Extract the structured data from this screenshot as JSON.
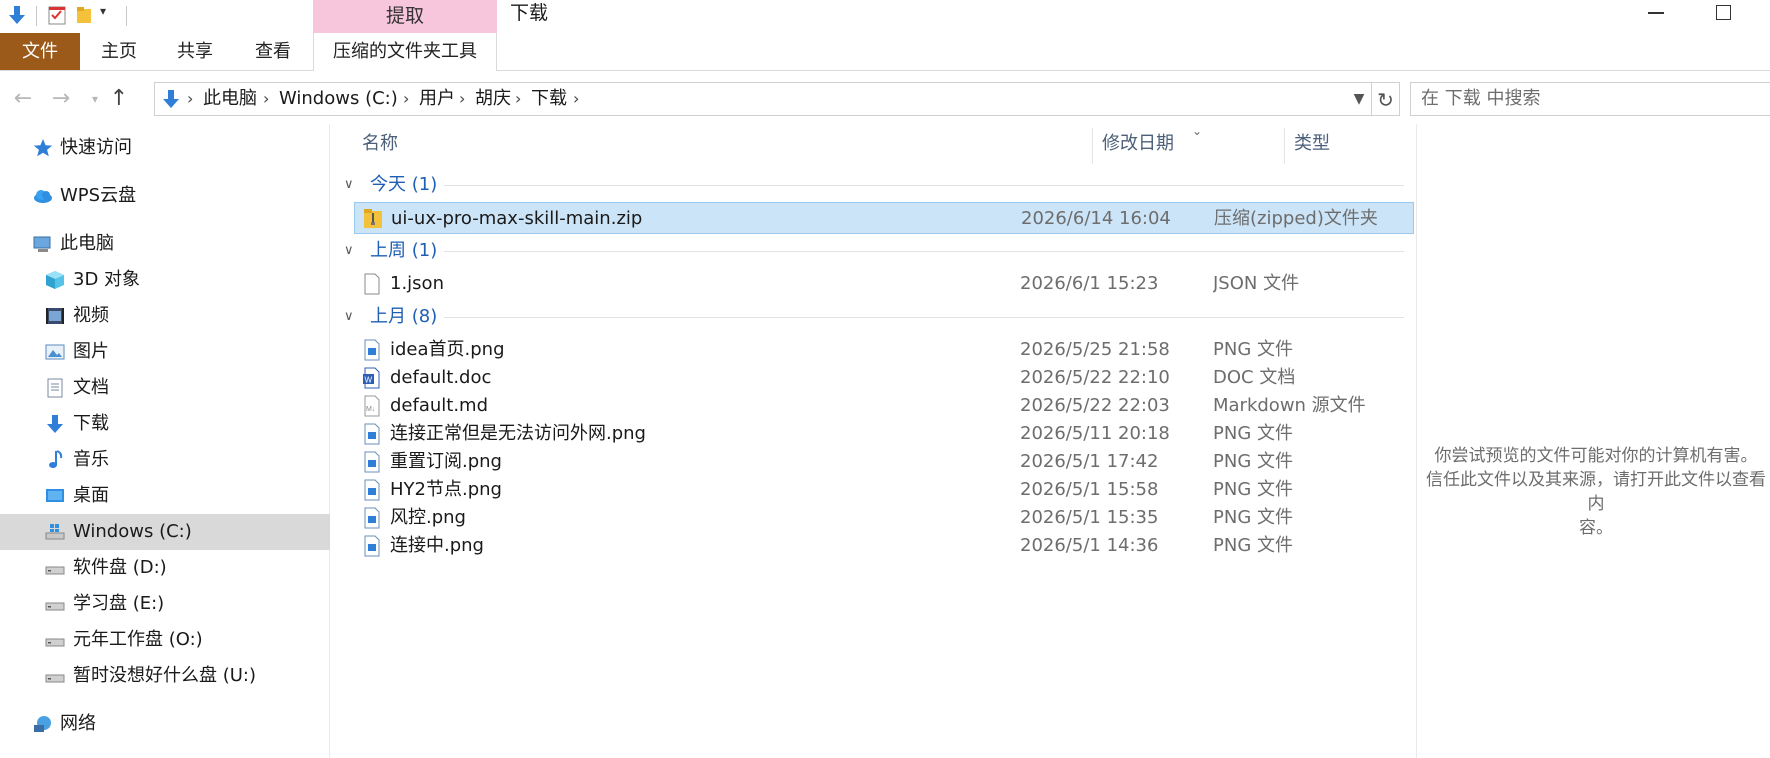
{
  "window": {
    "title": "下载",
    "extract_tab": "提取"
  },
  "ribbon": {
    "tabs": {
      "file": "文件",
      "home": "主页",
      "share": "共享",
      "view": "查看",
      "compress": "压缩的文件夹工具"
    }
  },
  "address": {
    "crumbs": [
      "此电脑",
      "Windows (C:)",
      "用户",
      "胡庆",
      "下载"
    ],
    "search_placeholder": "在 下载 中搜索"
  },
  "sidebar": {
    "items": [
      {
        "label": "快速访问",
        "icon": "star-icon"
      },
      {
        "label": "WPS云盘",
        "icon": "cloud-icon"
      },
      {
        "label": "此电脑",
        "icon": "computer-icon"
      },
      {
        "label": "3D 对象",
        "icon": "cube-icon"
      },
      {
        "label": "视频",
        "icon": "video-icon"
      },
      {
        "label": "图片",
        "icon": "picture-icon"
      },
      {
        "label": "文档",
        "icon": "document-icon"
      },
      {
        "label": "下载",
        "icon": "download-icon"
      },
      {
        "label": "音乐",
        "icon": "music-icon"
      },
      {
        "label": "桌面",
        "icon": "desktop-icon"
      },
      {
        "label": "Windows (C:)",
        "icon": "windows-drive-icon",
        "selected": true
      },
      {
        "label": "软件盘 (D:)",
        "icon": "drive-icon"
      },
      {
        "label": "学习盘 (E:)",
        "icon": "drive-icon"
      },
      {
        "label": "元年工作盘 (O:)",
        "icon": "drive-icon"
      },
      {
        "label": "暂时没想好什么盘 (U:)",
        "icon": "drive-icon"
      },
      {
        "label": "网络",
        "icon": "network-icon"
      }
    ]
  },
  "columns": {
    "name": "名称",
    "date": "修改日期",
    "type": "类型"
  },
  "groups": [
    {
      "label": "今天 (1)",
      "files": [
        {
          "name": "ui-ux-pro-max-skill-main.zip",
          "date": "2026/6/14 16:04",
          "type": "压缩(zipped)文件夹",
          "icon": "zip-icon",
          "selected": true
        }
      ]
    },
    {
      "label": "上周 (1)",
      "files": [
        {
          "name": "1.json",
          "date": "2026/6/1 15:23",
          "type": "JSON 文件",
          "icon": "blank-file-icon"
        }
      ]
    },
    {
      "label": "上月 (8)",
      "files": [
        {
          "name": "idea首页.png",
          "date": "2026/5/25 21:58",
          "type": "PNG 文件",
          "icon": "png-file-icon"
        },
        {
          "name": "default.doc",
          "date": "2026/5/22 22:10",
          "type": "DOC 文档",
          "icon": "word-file-icon"
        },
        {
          "name": "default.md",
          "date": "2026/5/22 22:03",
          "type": "Markdown 源文件",
          "icon": "markdown-file-icon"
        },
        {
          "name": "连接正常但是无法访问外网.png",
          "date": "2026/5/11 20:18",
          "type": "PNG 文件",
          "icon": "png-file-icon"
        },
        {
          "name": "重置订阅.png",
          "date": "2026/5/1 17:42",
          "type": "PNG 文件",
          "icon": "png-file-icon"
        },
        {
          "name": "HY2节点.png",
          "date": "2026/5/1 15:58",
          "type": "PNG 文件",
          "icon": "png-file-icon"
        },
        {
          "name": "风控.png",
          "date": "2026/5/1 15:35",
          "type": "PNG 文件",
          "icon": "png-file-icon"
        },
        {
          "name": "连接中.png",
          "date": "2026/5/1 14:36",
          "type": "PNG 文件",
          "icon": "png-file-icon"
        }
      ]
    }
  ],
  "preview": {
    "message": "你尝试预览的文件可能对你的计算机有害。\n信任此文件以及其来源，请打开此文件以查看内\n容。"
  }
}
